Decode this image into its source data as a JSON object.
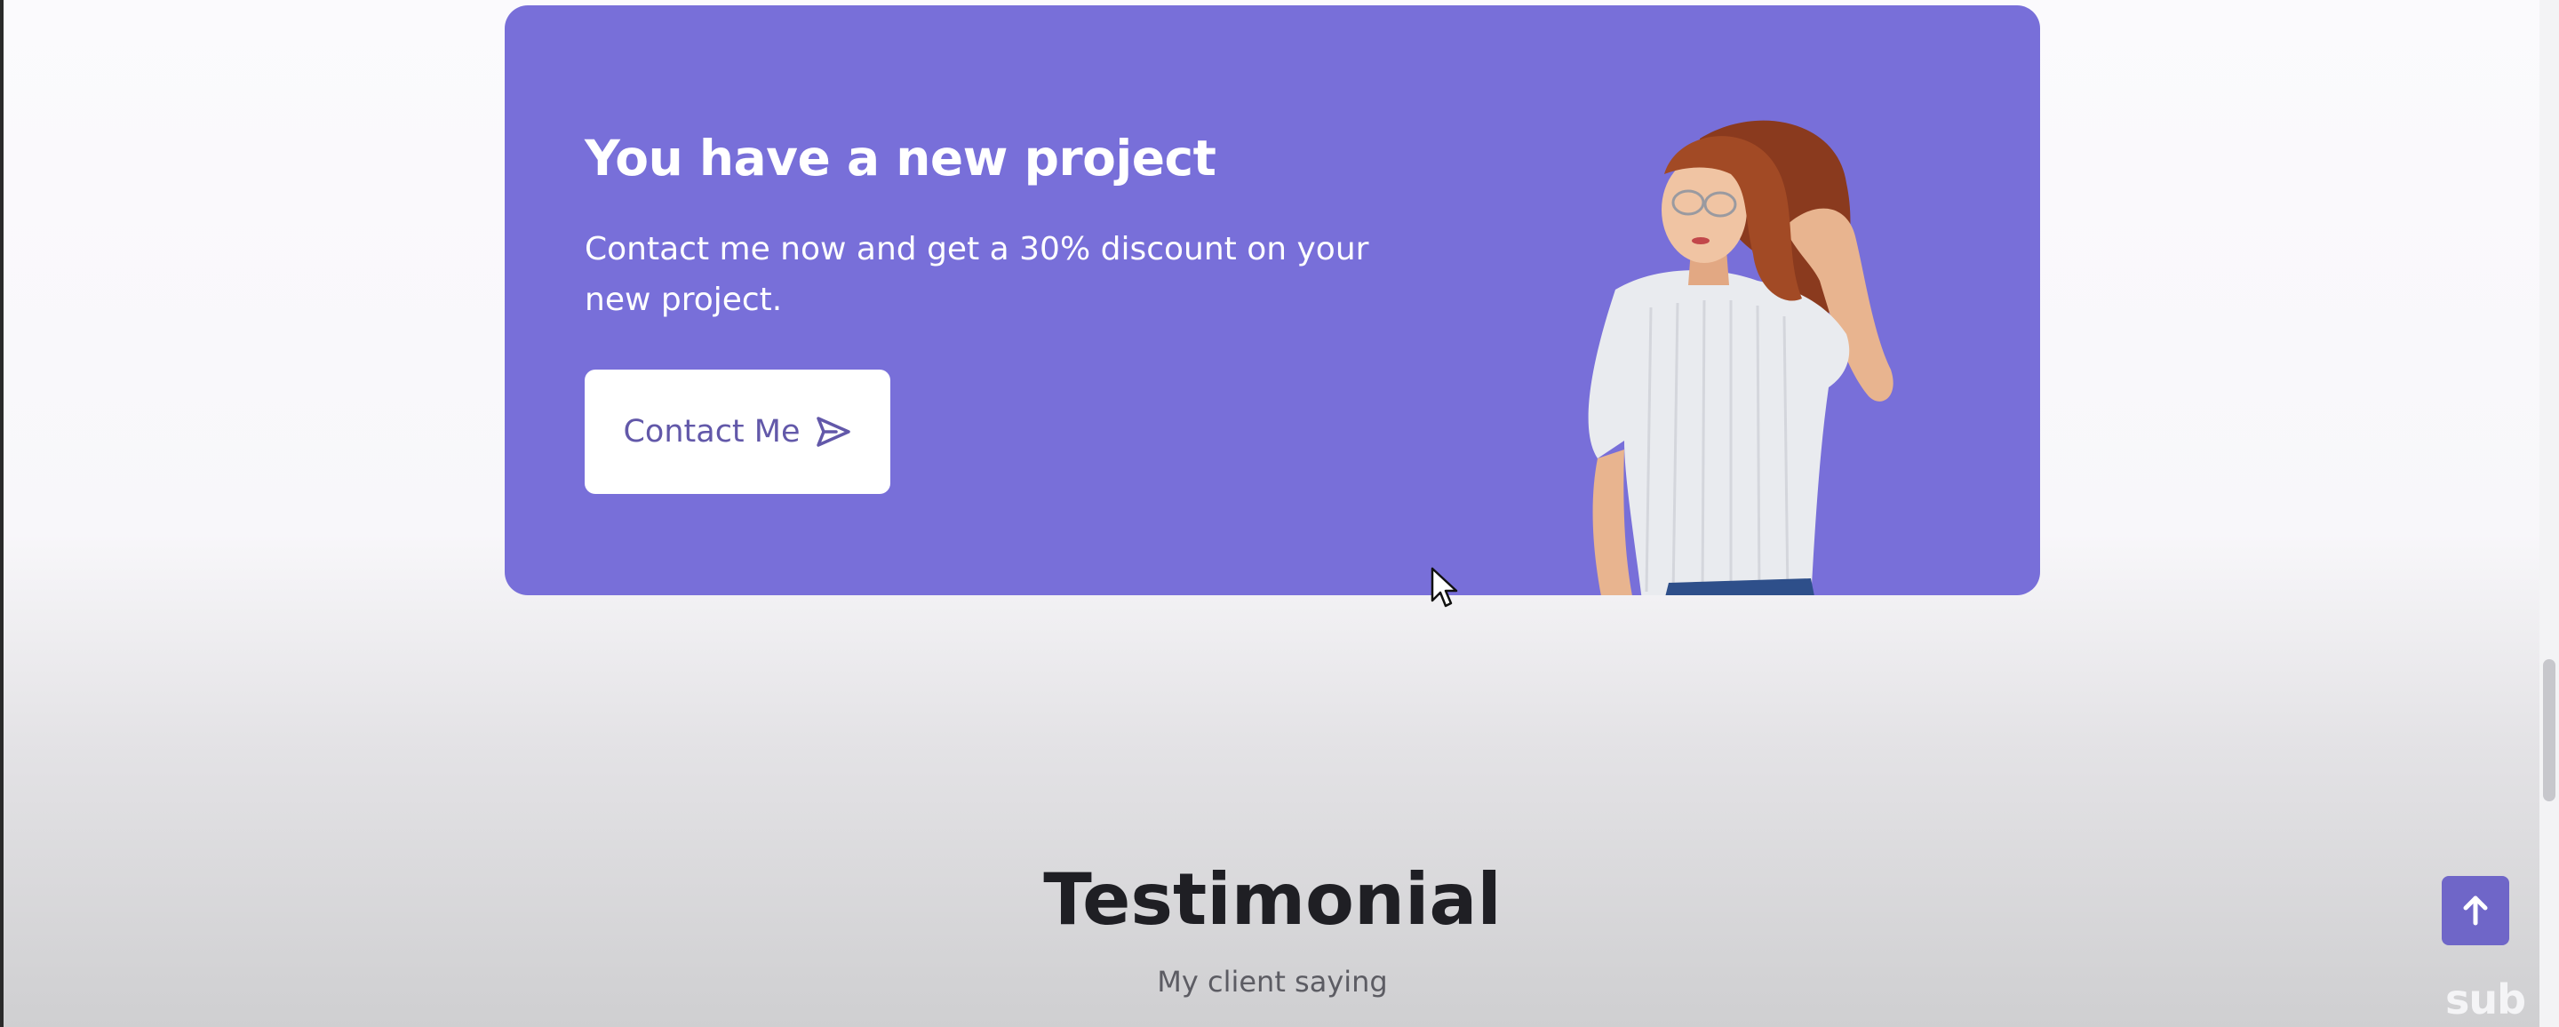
{
  "banner": {
    "title": "You have a new project",
    "text": "Contact me now and get a 30% discount on your new project.",
    "button_label": "Contact Me",
    "button_icon": "send-icon"
  },
  "testimonial": {
    "title": "Testimonial",
    "subtitle": "My client saying"
  },
  "scroll_up_icon": "arrow-up-icon",
  "watermark": "sub",
  "colors": {
    "accent": "#786fd9",
    "button_text": "#6258a9",
    "scroll_button": "#6f66c8",
    "heading": "#1f1f24"
  }
}
